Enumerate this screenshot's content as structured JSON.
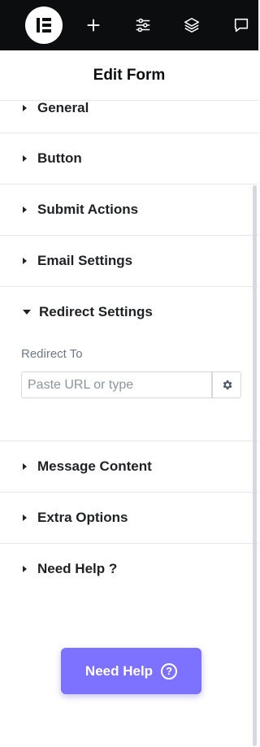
{
  "topbar": {
    "logo_icon": "elementor-logo-icon",
    "icons": [
      "plus-icon",
      "sliders-icon",
      "layers-icon",
      "comment-icon"
    ]
  },
  "header": {
    "title": "Edit Form"
  },
  "sections": {
    "general": {
      "label": "General",
      "expanded": false
    },
    "button": {
      "label": "Button",
      "expanded": false
    },
    "submit_actions": {
      "label": "Submit Actions",
      "expanded": false
    },
    "email_settings": {
      "label": "Email Settings",
      "expanded": false
    },
    "redirect_settings": {
      "label": "Redirect Settings",
      "expanded": true,
      "field_label": "Redirect To",
      "input_value": "",
      "input_placeholder": "Paste URL or type",
      "dynamic_icon": "gear-icon"
    },
    "message_content": {
      "label": "Message Content",
      "expanded": false
    },
    "extra_options": {
      "label": "Extra Options",
      "expanded": false
    },
    "need_help": {
      "label": "Need Help ?",
      "expanded": false
    }
  },
  "help_button": {
    "label": "Need Help",
    "icon_text": "?",
    "color": "#7d72ff"
  },
  "colors": {
    "topbar": "#0c0d0e",
    "accent": "#7d72ff",
    "divider": "#e6e8ea"
  }
}
